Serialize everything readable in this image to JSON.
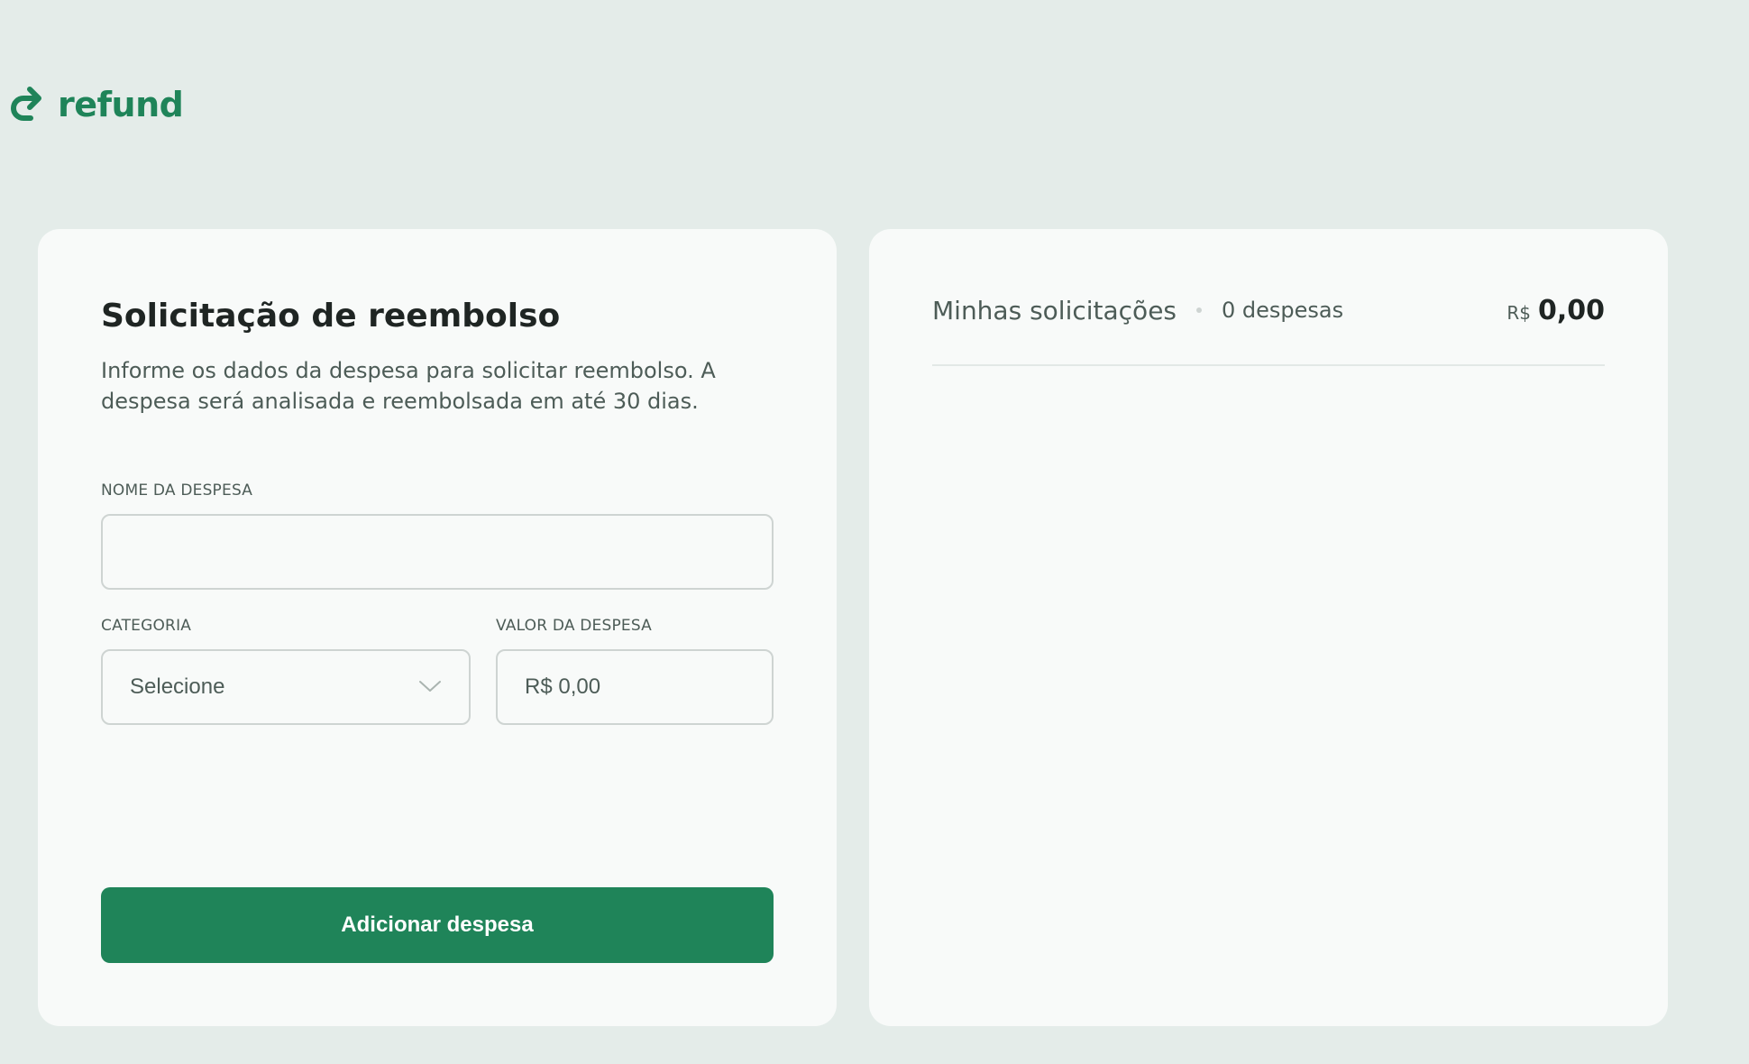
{
  "brand": {
    "name": "refund",
    "icon": "refund-arrow-icon",
    "accent": "#1f8459"
  },
  "form": {
    "title": "Solicitação de reembolso",
    "description": "Informe os dados da despesa para solicitar reembolso. A despesa será analisada e reembolsada em até 30 dias.",
    "expense_name": {
      "label": "NOME DA DESPESA",
      "value": ""
    },
    "category": {
      "label": "CATEGORIA",
      "selected": "Selecione",
      "icon": "chevron-down-icon"
    },
    "amount": {
      "label": "VALOR DA DESPESA",
      "placeholder": "R$ 0,00"
    },
    "submit_label": "Adicionar despesa"
  },
  "requests": {
    "title": "Minhas solicitações",
    "count": "0 despesas",
    "currency": "R$",
    "total": "0,00"
  }
}
